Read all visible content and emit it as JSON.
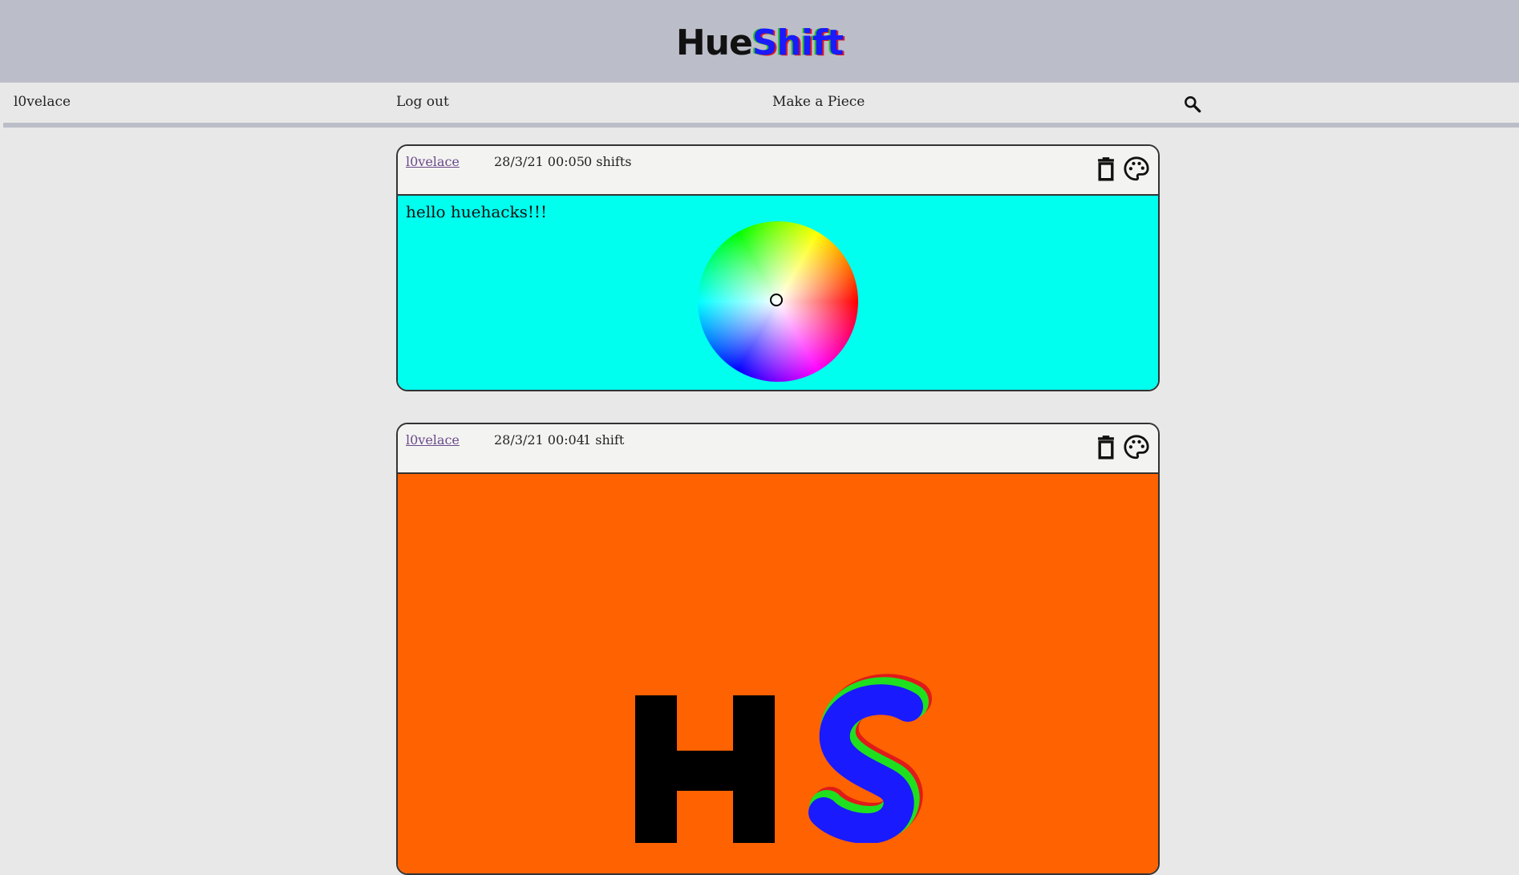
{
  "app": {
    "logo_hue": "Hue",
    "logo_shift": "Shift"
  },
  "nav": {
    "user": "l0velace",
    "logout": "Log out",
    "make_piece": "Make a Piece",
    "search_icon": "search-icon"
  },
  "posts": [
    {
      "author": "l0velace",
      "date": "28/3/21 00:05",
      "shifts": "0 shifts",
      "text": "hello huehacks!!!",
      "background": "#00ffee",
      "content_type": "color-wheel"
    },
    {
      "author": "l0velace",
      "date": "28/3/21 00:04",
      "shifts": "1 shift",
      "text": "",
      "background": "#ff6200",
      "content_type": "hueshift-logo-image"
    }
  ],
  "icons": {
    "delete": "trash-icon",
    "palette": "palette-icon"
  },
  "colors": {
    "banner": "#bbbec8",
    "page_bg": "#e8e8e8",
    "card_header": "#f3f3f1",
    "link": "#6a4a8a"
  }
}
